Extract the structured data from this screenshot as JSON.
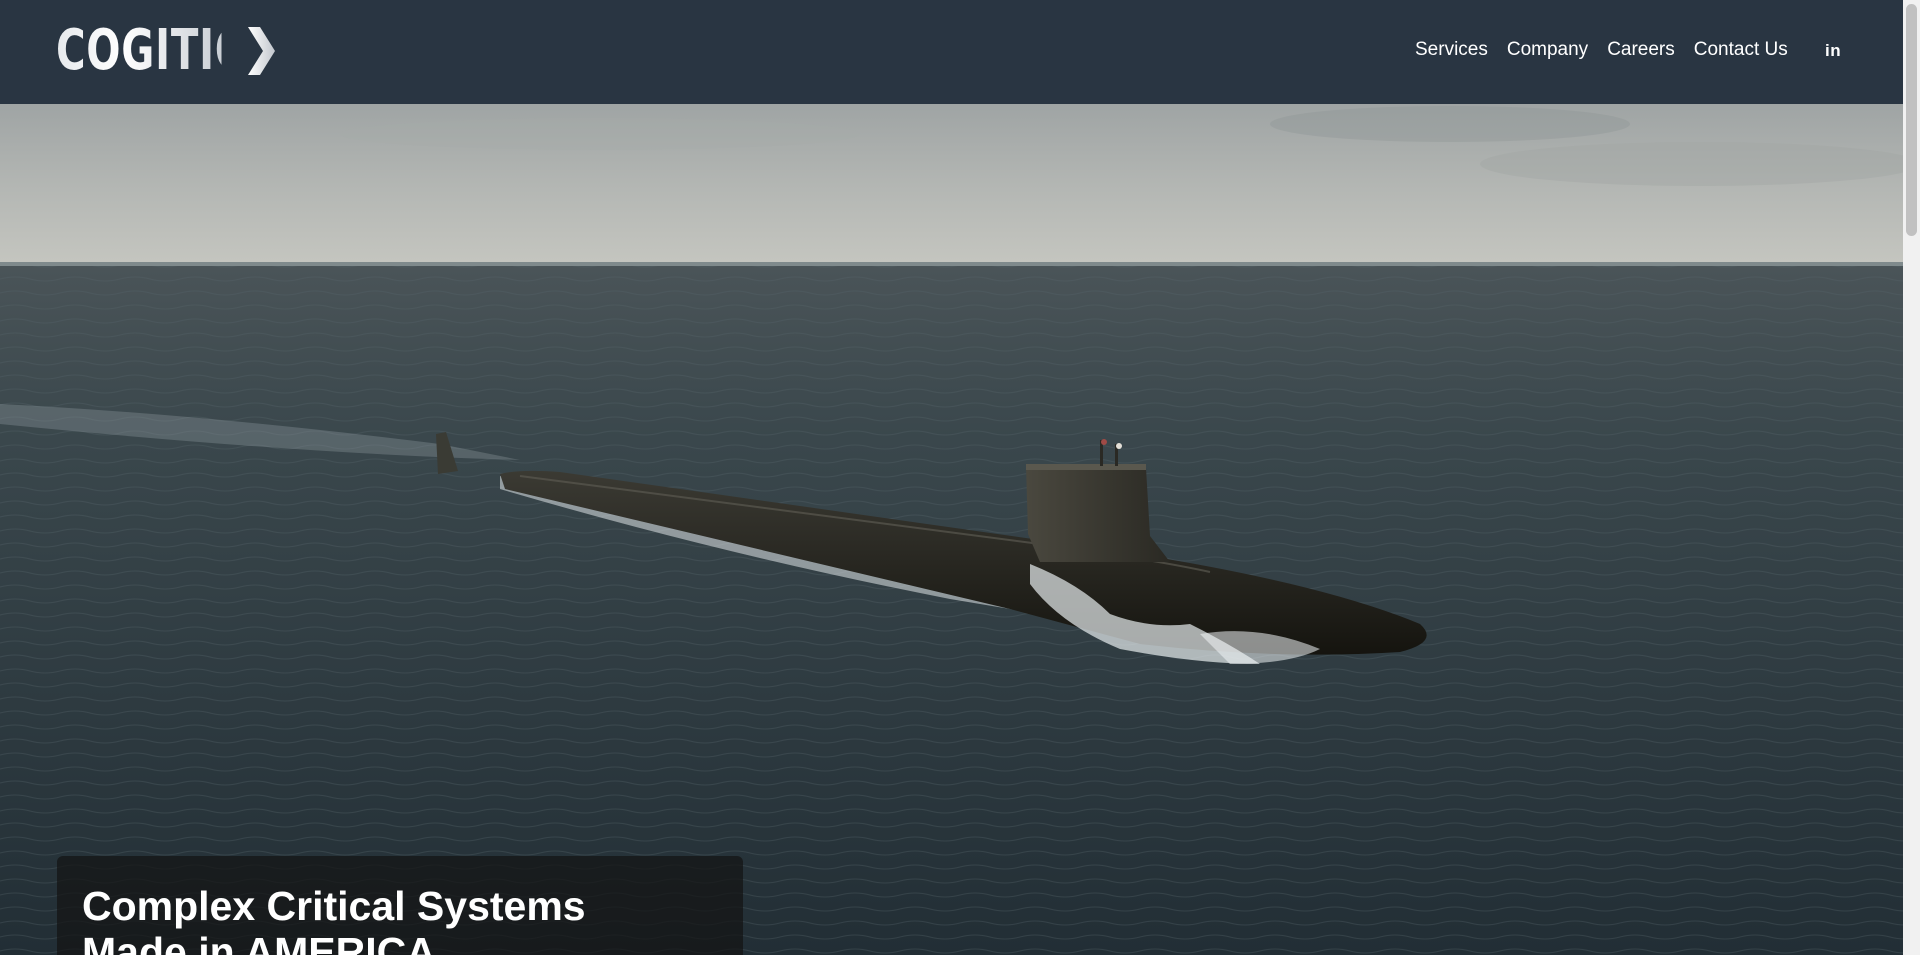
{
  "header": {
    "logo_text": "COGITIC",
    "nav": [
      {
        "label": "Services"
      },
      {
        "label": "Company"
      },
      {
        "label": "Careers"
      },
      {
        "label": "Contact Us"
      }
    ],
    "social_icon": "linkedin-icon",
    "social_label": "in"
  },
  "hero": {
    "image": "submarine-surfaced-at-sea",
    "caption_line_1": "Complex Critical Systems",
    "caption_line_2": "Made in AMERICA"
  },
  "colors": {
    "header_bg": "#293542",
    "caption_bg": "#141414",
    "text": "#ffffff",
    "sea": "#2c3a42",
    "sky": "#b9bcbc"
  }
}
